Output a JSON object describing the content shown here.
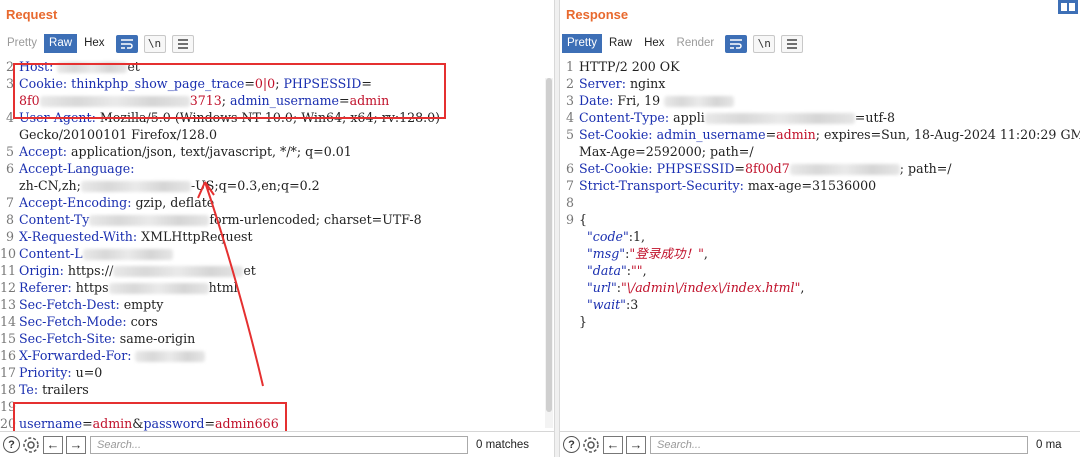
{
  "request": {
    "title": "Request",
    "tabs": [
      "Pretty",
      "Raw",
      "Hex"
    ],
    "active_tab": "Raw",
    "lines": [
      {
        "n": "2",
        "segs": [
          [
            "k",
            "Host: "
          ],
          [
            "b",
            ""
          ],
          [
            "p",
            "et"
          ]
        ]
      },
      {
        "n": "3",
        "segs": [
          [
            "k",
            "Cookie: "
          ],
          [
            "k",
            "thinkphp_show_page_trace"
          ],
          [
            "p",
            "="
          ],
          [
            "v",
            "0|0"
          ],
          [
            "p",
            "; "
          ],
          [
            "k",
            "PHPSESSID"
          ],
          [
            "p",
            "="
          ]
        ]
      },
      {
        "n": "",
        "segs": [
          [
            "v",
            "8f0"
          ],
          [
            "b",
            ""
          ],
          [
            "v",
            "3713"
          ],
          [
            "p",
            "; "
          ],
          [
            "k",
            "admin_username"
          ],
          [
            "p",
            "="
          ],
          [
            "v",
            "admin"
          ]
        ]
      },
      {
        "n": "4",
        "segs": [
          [
            "k",
            "User-Agent: "
          ],
          [
            "p",
            "Mozilla/5.0 (Windows NT 10.0; Win64; x64; rv:128.0)"
          ]
        ]
      },
      {
        "n": "",
        "segs": [
          [
            "p",
            "Gecko/20100101 Firefox/128.0"
          ]
        ]
      },
      {
        "n": "5",
        "segs": [
          [
            "k",
            "Accept: "
          ],
          [
            "p",
            "application/json, text/javascript, */*; q=0.01"
          ]
        ]
      },
      {
        "n": "6",
        "segs": [
          [
            "k",
            "Accept-Language: "
          ]
        ]
      },
      {
        "n": "",
        "segs": [
          [
            "p",
            "zh-CN,zh;"
          ],
          [
            "b",
            ""
          ],
          [
            "p",
            "-US;q=0.3,en;q=0.2"
          ]
        ]
      },
      {
        "n": "7",
        "segs": [
          [
            "k",
            "Accept-Encoding: "
          ],
          [
            "p",
            "gzip, deflate"
          ]
        ]
      },
      {
        "n": "8",
        "segs": [
          [
            "k",
            "Content-Ty"
          ],
          [
            "b",
            ""
          ],
          [
            "p",
            "form-urlencoded; charset=UTF-8"
          ]
        ]
      },
      {
        "n": "9",
        "segs": [
          [
            "k",
            "X-Requested-With: "
          ],
          [
            "p",
            "XMLHttpRequest"
          ]
        ]
      },
      {
        "n": "10",
        "segs": [
          [
            "k",
            "Content-L"
          ],
          [
            "b",
            ""
          ]
        ]
      },
      {
        "n": "11",
        "segs": [
          [
            "k",
            "Origin: "
          ],
          [
            "p",
            "https://"
          ],
          [
            "b",
            ""
          ],
          [
            "p",
            "et"
          ]
        ]
      },
      {
        "n": "12",
        "segs": [
          [
            "k",
            "Referer: "
          ],
          [
            "p",
            "https"
          ],
          [
            "b",
            ""
          ],
          [
            "p",
            "html"
          ]
        ]
      },
      {
        "n": "13",
        "segs": [
          [
            "k",
            "Sec-Fetch-Dest: "
          ],
          [
            "p",
            "empty"
          ]
        ]
      },
      {
        "n": "14",
        "segs": [
          [
            "k",
            "Sec-Fetch-Mode: "
          ],
          [
            "p",
            "cors"
          ]
        ]
      },
      {
        "n": "15",
        "segs": [
          [
            "k",
            "Sec-Fetch-Site: "
          ],
          [
            "p",
            "same-origin"
          ]
        ]
      },
      {
        "n": "16",
        "segs": [
          [
            "k",
            "X-Forwarded-For: "
          ],
          [
            "b",
            ""
          ]
        ]
      },
      {
        "n": "17",
        "segs": [
          [
            "k",
            "Priority: "
          ],
          [
            "p",
            "u=0"
          ]
        ]
      },
      {
        "n": "18",
        "segs": [
          [
            "k",
            "Te: "
          ],
          [
            "p",
            "trailers"
          ]
        ]
      },
      {
        "n": "19",
        "segs": []
      },
      {
        "n": "20",
        "segs": [
          [
            "k",
            "username"
          ],
          [
            "p",
            "="
          ],
          [
            "v",
            "admin"
          ],
          [
            "p",
            "&"
          ],
          [
            "k",
            "password"
          ],
          [
            "p",
            "="
          ],
          [
            "v",
            "admin666"
          ]
        ]
      }
    ],
    "search_placeholder": "Search...",
    "matches": "0 matches"
  },
  "response": {
    "title": "Response",
    "tabs": [
      "Pretty",
      "Raw",
      "Hex",
      "Render"
    ],
    "active_tab": "Pretty",
    "lines": [
      {
        "n": "1",
        "segs": [
          [
            "p",
            "HTTP/2 200 OK"
          ]
        ]
      },
      {
        "n": "2",
        "segs": [
          [
            "k",
            "Server: "
          ],
          [
            "p",
            "nginx"
          ]
        ]
      },
      {
        "n": "3",
        "segs": [
          [
            "k",
            "Date: "
          ],
          [
            "p",
            "Fri, 19 "
          ],
          [
            "b",
            ""
          ]
        ]
      },
      {
        "n": "4",
        "segs": [
          [
            "k",
            "Content-Type: "
          ],
          [
            "p",
            "appli"
          ],
          [
            "b",
            ""
          ],
          [
            "p",
            "=utf-8"
          ]
        ]
      },
      {
        "n": "5",
        "segs": [
          [
            "k",
            "Set-Cookie: "
          ],
          [
            "k",
            "admin_username"
          ],
          [
            "p",
            "="
          ],
          [
            "v",
            "admin"
          ],
          [
            "p",
            "; expires=Sun, 18-Aug-2024 11:20:29 GM"
          ]
        ]
      },
      {
        "n": "",
        "segs": [
          [
            "p",
            "Max-Age=2592000; path=/"
          ]
        ]
      },
      {
        "n": "6",
        "segs": [
          [
            "k",
            "Set-Cookie: "
          ],
          [
            "k",
            "PHPSESSID"
          ],
          [
            "p",
            "="
          ],
          [
            "v",
            "8f00d7"
          ],
          [
            "b",
            ""
          ],
          [
            "p",
            "; path=/"
          ]
        ]
      },
      {
        "n": "7",
        "segs": [
          [
            "k",
            "Strict-Transport-Security: "
          ],
          [
            "p",
            "max-age=31536000"
          ]
        ]
      },
      {
        "n": "8",
        "segs": []
      },
      {
        "n": "9",
        "segs": [
          [
            "p",
            "{"
          ]
        ]
      },
      {
        "n": "",
        "segs": [
          [
            "p",
            "  "
          ],
          [
            "key",
            "\"code\""
          ],
          [
            "p",
            ":1,"
          ]
        ]
      },
      {
        "n": "",
        "segs": [
          [
            "p",
            "  "
          ],
          [
            "key",
            "\"msg\""
          ],
          [
            "p",
            ":"
          ],
          [
            "s",
            "\"登录成功！\""
          ],
          [
            "p",
            ","
          ]
        ]
      },
      {
        "n": "",
        "segs": [
          [
            "p",
            "  "
          ],
          [
            "key",
            "\"data\""
          ],
          [
            "p",
            ":"
          ],
          [
            "s",
            "\"\""
          ],
          [
            "p",
            ","
          ]
        ]
      },
      {
        "n": "",
        "segs": [
          [
            "p",
            "  "
          ],
          [
            "key",
            "\"url\""
          ],
          [
            "p",
            ":"
          ],
          [
            "s",
            "\"\\/admin\\/index\\/index.html\""
          ],
          [
            "p",
            ","
          ]
        ]
      },
      {
        "n": "",
        "segs": [
          [
            "p",
            "  "
          ],
          [
            "key",
            "\"wait\""
          ],
          [
            "p",
            ":3"
          ]
        ]
      },
      {
        "n": "",
        "segs": [
          [
            "p",
            "}"
          ]
        ]
      }
    ],
    "search_placeholder": "Search...",
    "matches": "0 ma"
  },
  "colors": {
    "title": "#e8692e",
    "tab_active": "#3d6fb6",
    "key": "#1a2fb0",
    "value": "#c0102a",
    "highlight": "#e53030"
  },
  "icons": {
    "help": "help-icon",
    "settings": "gear-icon",
    "back": "arrow-left-icon",
    "forward": "arrow-right-icon",
    "wrap": "word-wrap-icon",
    "newline": "newline-icon",
    "menu": "menu-icon"
  }
}
